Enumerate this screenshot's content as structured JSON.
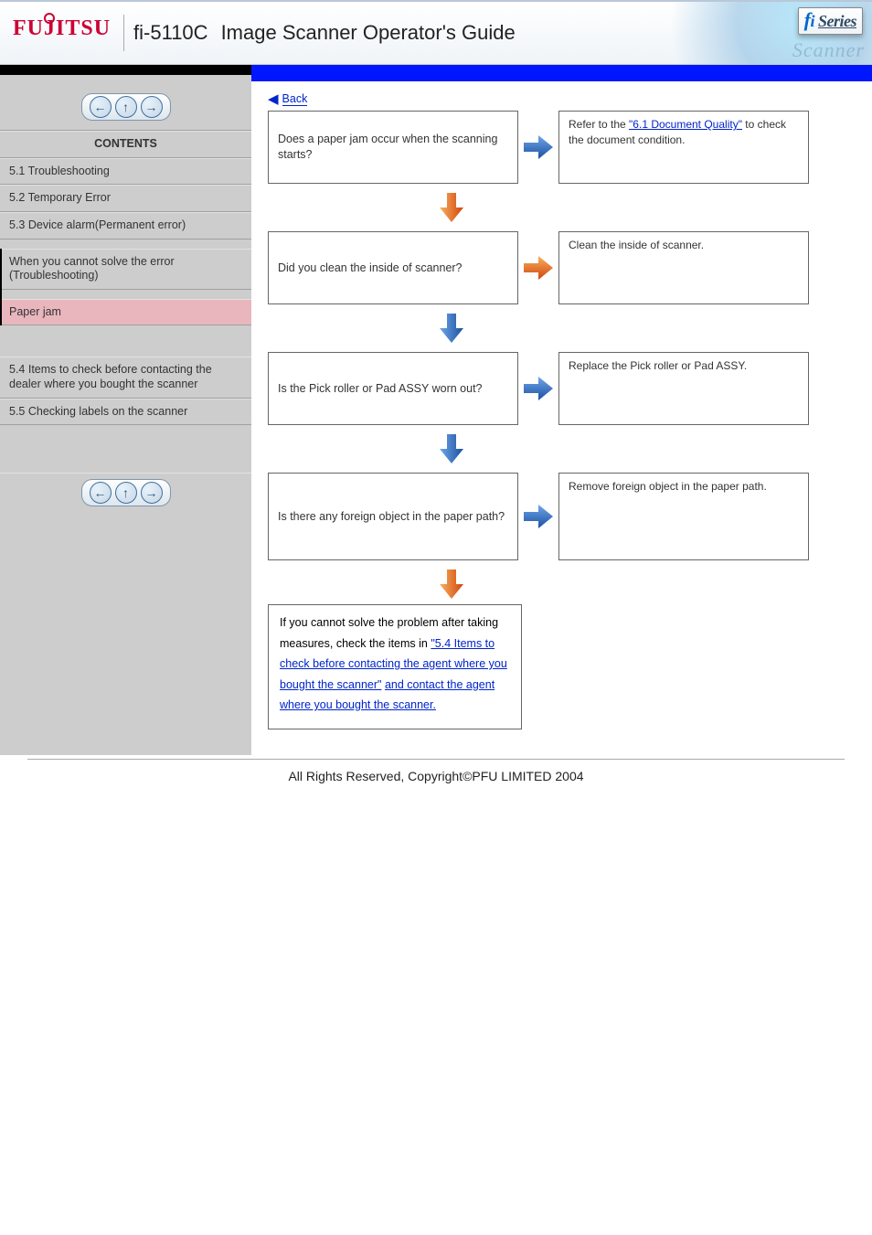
{
  "header": {
    "brand": "FUJITSU",
    "model": "fi-5110C",
    "title": "Image Scanner Operator's Guide",
    "badge_f": "f",
    "badge_i": "i",
    "badge_series": "Series",
    "wash_text": "Scanner"
  },
  "sidebar": {
    "contents_label": "CONTENTS",
    "sections": [
      "5.1 Troubleshooting",
      "5.2 Temporary Error",
      "5.3 Device alarm(Permanent error)",
      "When you cannot solve the error (Troubleshooting)",
      "Paper jam",
      "5.4 Items to check before contacting the dealer where you bought the scanner",
      "5.5 Checking labels on the scanner"
    ],
    "highlight_index": 4,
    "bracket_start": 3,
    "bracket_end": 4
  },
  "nav_icons": {
    "prev": "←",
    "up": "↑",
    "next": "→"
  },
  "flow": {
    "back_label": "Back",
    "steps": [
      {
        "text": "Does a paper jam occur when the scanning starts?",
        "ref_prefix": "Refer to the ",
        "ref_link": "\"6.1 Document Quality\"",
        "ref_suffix": " to check the document condition.",
        "arrow_color": "blue"
      },
      {
        "text": "Did you clean the inside of scanner?",
        "ref": "Clean the inside of scanner.",
        "arrow_color": "orange"
      },
      {
        "text": "Is the Pick roller or Pad ASSY worn out?",
        "ref": "Replace the Pick roller or Pad ASSY.",
        "arrow_color": "blue"
      },
      {
        "text": "Is there any foreign object in the paper path?",
        "ref": "Remove foreign object in the paper path.",
        "arrow_color": "blue"
      }
    ],
    "final": {
      "lead": "If you cannot solve the problem after taking measures, check the items in",
      "links": [
        "\"5.4 Items to check before contacting the agent where you bought the scanner\"",
        "and contact the agent where you bought the scanner."
      ],
      "arrow_color": "orange"
    }
  },
  "footer": "All Rights Reserved, Copyright©PFU LIMITED 2004"
}
